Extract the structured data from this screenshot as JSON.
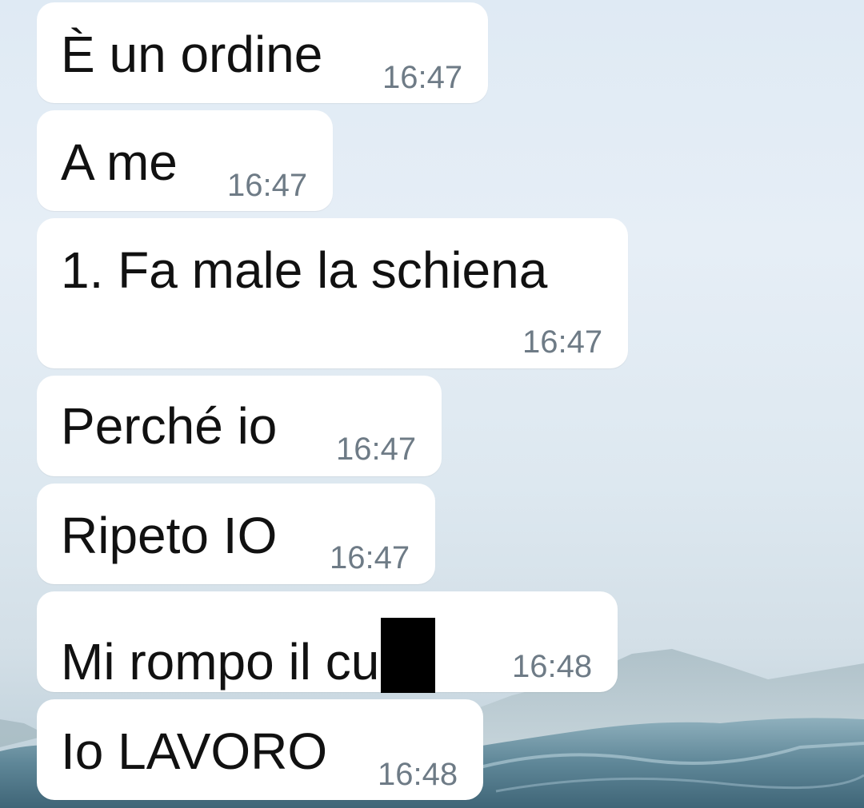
{
  "messages": [
    {
      "text": "È un ordine",
      "time": "16:47"
    },
    {
      "text": "A me",
      "time": "16:47"
    },
    {
      "text": "1. Fa male la schiena",
      "time": "16:47"
    },
    {
      "text": "Perché io",
      "time": "16:47"
    },
    {
      "text": "Ripeto IO",
      "time": "16:47"
    },
    {
      "text": "Mi rompo il cu",
      "time": "16:48",
      "redacted_suffix": true
    },
    {
      "text": "Io LAVORO",
      "time": "16:48"
    }
  ],
  "colors": {
    "bubble": "#ffffff",
    "text": "#111111",
    "timestamp": "#6e7b86",
    "sky": "#e2ecf5",
    "water": "#6f93a3"
  }
}
